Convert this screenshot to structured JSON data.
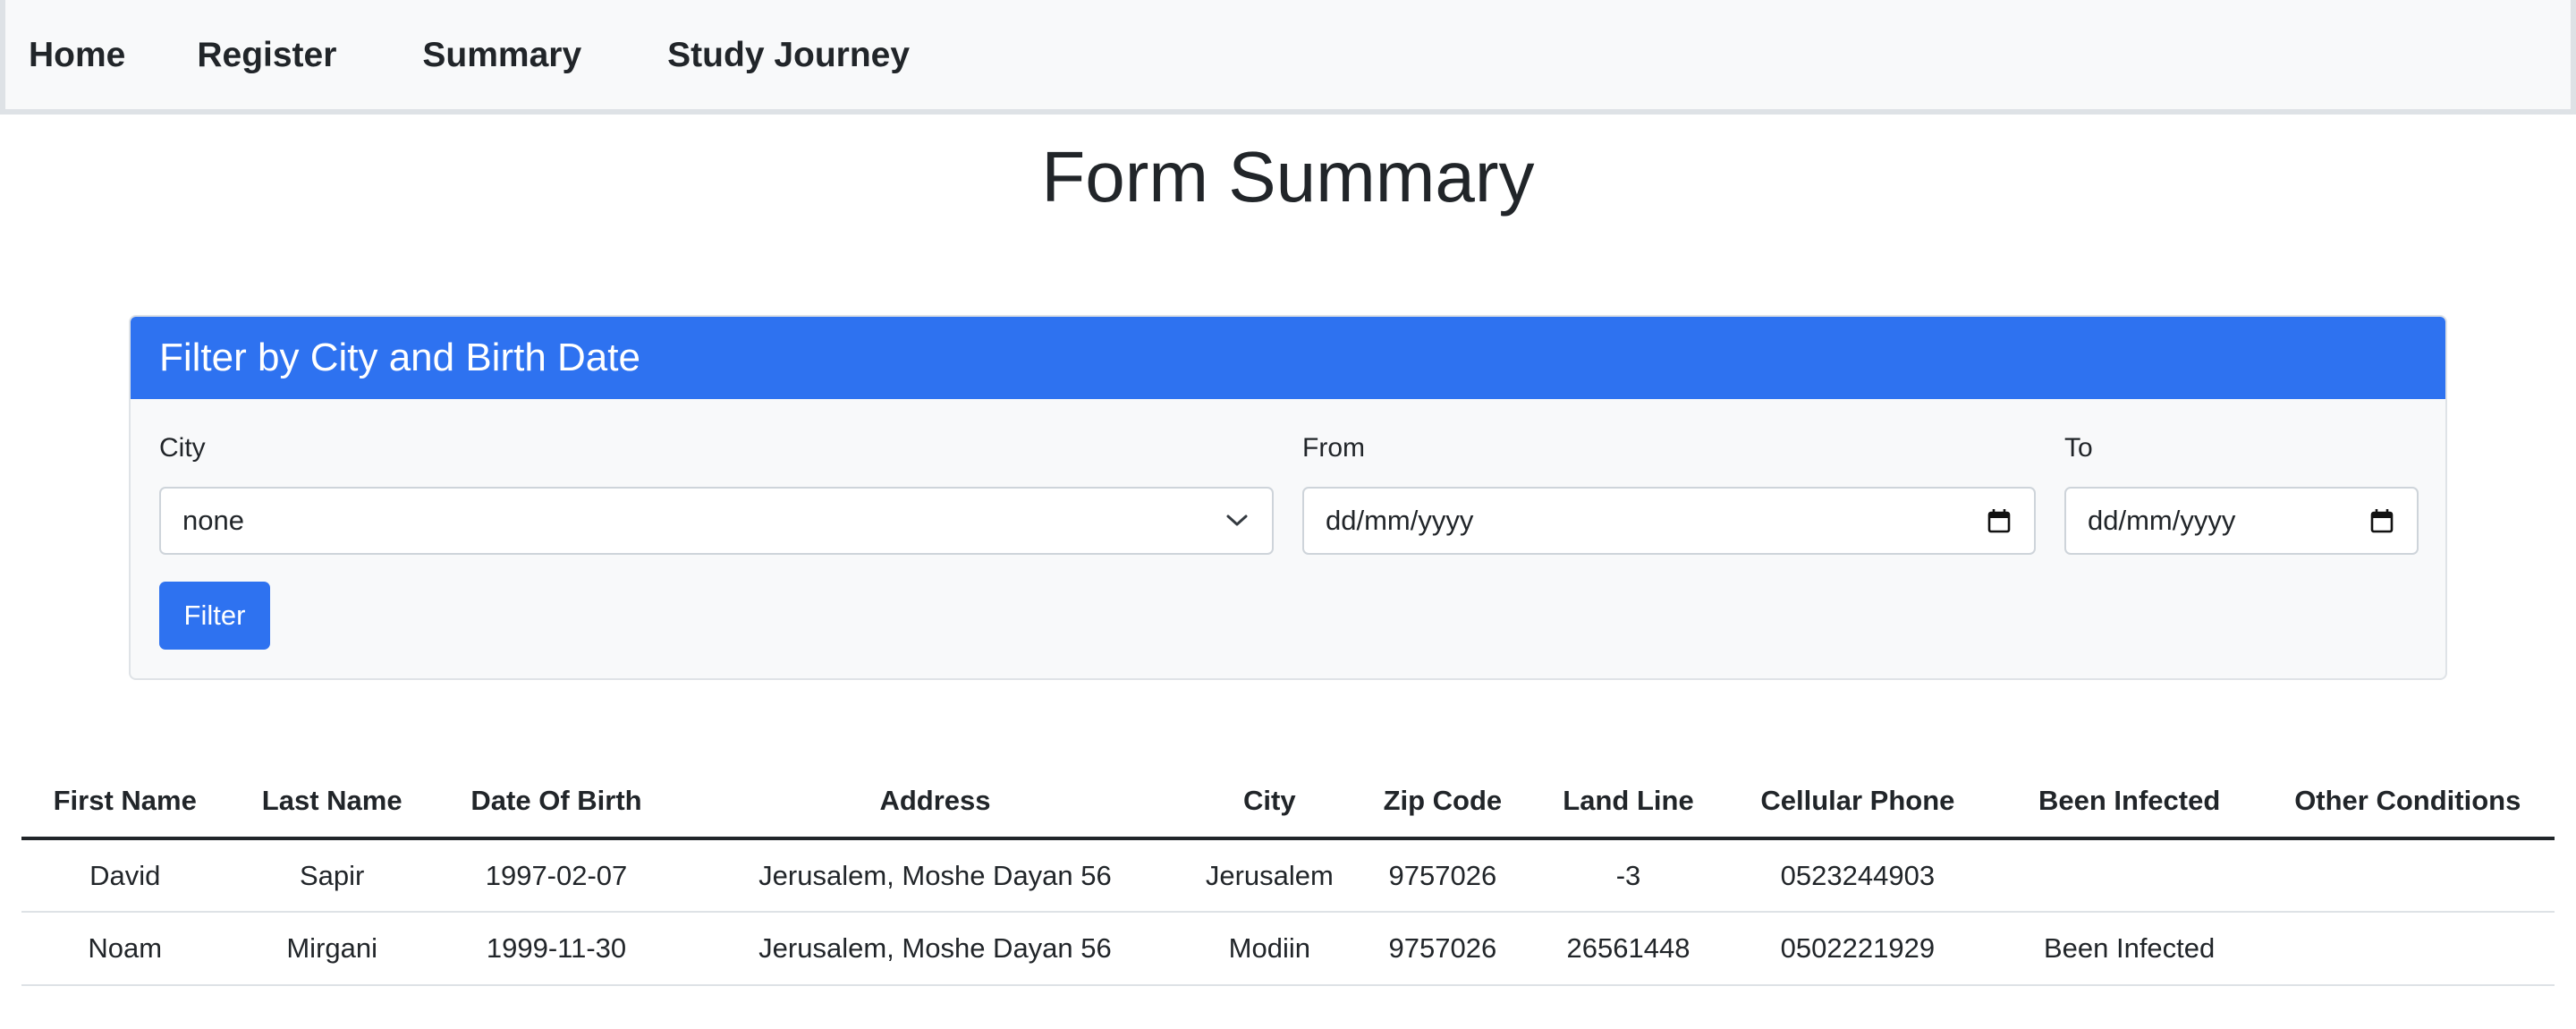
{
  "nav": {
    "items": [
      {
        "label": "Home"
      },
      {
        "label": "Register"
      },
      {
        "label": "Summary"
      },
      {
        "label": "Study Journey"
      }
    ]
  },
  "page": {
    "title": "Form Summary"
  },
  "filter": {
    "header": "Filter by City and Birth Date",
    "city_label": "City",
    "city_value": "none",
    "from_label": "From",
    "from_placeholder": "dd/mm/yyyy",
    "to_label": "To",
    "to_placeholder": "dd/mm/yyyy",
    "button_label": "Filter"
  },
  "table": {
    "columns": [
      "First Name",
      "Last Name",
      "Date Of Birth",
      "Address",
      "City",
      "Zip Code",
      "Land Line",
      "Cellular Phone",
      "Been Infected",
      "Other Conditions"
    ],
    "rows": [
      [
        "David",
        "Sapir",
        "1997-02-07",
        "Jerusalem, Moshe Dayan 56",
        "Jerusalem",
        "9757026",
        "-3",
        "0523244903",
        "",
        ""
      ],
      [
        "Noam",
        "Mirgani",
        "1999-11-30",
        "Jerusalem, Moshe Dayan 56",
        "Modiin",
        "9757026",
        "26561448",
        "0502221929",
        "Been Infected",
        ""
      ]
    ]
  },
  "colors": {
    "primary": "#2e72f0",
    "navbar_bg": "#f8f9fa",
    "text": "#212529"
  },
  "icons": {
    "select": "chevron-down-icon",
    "date": "calendar-icon"
  }
}
